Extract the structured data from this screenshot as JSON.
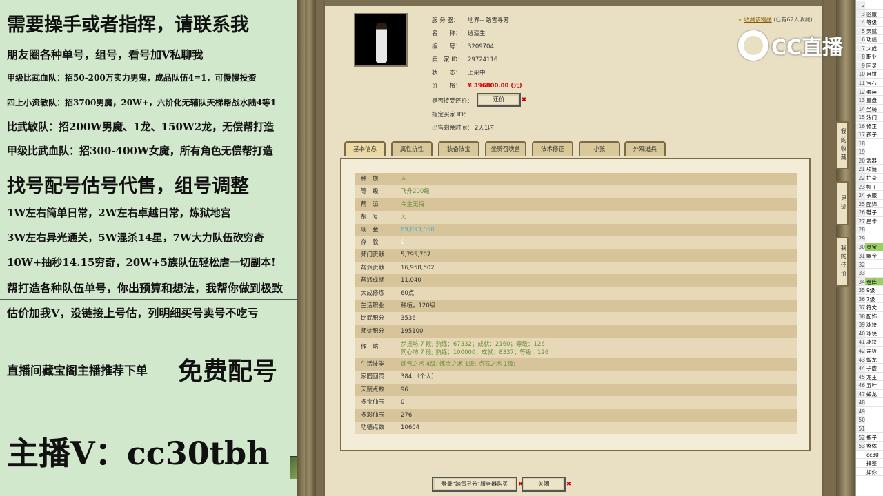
{
  "left_panel": {
    "lines": [
      "需要操手或者指挥，请联系我",
      "朋友圈各种单号，组号，看号加V私聊我",
      "甲级比武血队：招50-200万实力男鬼，成品队伍4=1，可慢慢投资",
      "四上小资敏队：招3700男魔，20W+，六阶化无辅队天梯帮战水陆4等1",
      "比武敏队：招200W男魔、1龙、150W2龙，无偿帮打造",
      "甲级比武血队：招300-400W女魔，所有角色无偿帮打造",
      "找号配号估号代售，组号调整",
      "1W左右简单日常，2W左右卓越日常，炼狱地宫",
      "3W左右异光通关，5W混杀14星，7W大力队伍砍穷奇",
      "10W+抽秒14.15穷奇，20W+5族队伍轻松虐一切副本!",
      "帮打造各种队伍单号，你出预算和想法，我帮你做到极致",
      "估价加我V，没链接上号估，列明细买号卖号不吃亏",
      "直播间藏宝阁主播推荐下单",
      "免费配号",
      "主播V：cc30tbh"
    ]
  },
  "watermark": "CC直播",
  "favorite": {
    "label": "收藏该物品",
    "count": "(已有62人收藏)"
  },
  "info": {
    "server_k": "服 务 器：",
    "server_v": "地界-- 踏雪寻芳",
    "name_k": "名　　称：",
    "name_v": "逍遥生",
    "id_k": "编　　号：",
    "id_v": "3209704",
    "seller_k": "卖　家 ID：",
    "seller_v": "29724116",
    "status_k": "状　　态：",
    "status_v": "上架中",
    "price_k": "价　　格：",
    "price_v": "¥ 396800.00 (元)",
    "bargain_k": "是否接受还价：",
    "bargain_btn": "还价",
    "buyer_k": "指定买家 ID：",
    "time_k": "出售剩余时间：",
    "time_v": "2天1时"
  },
  "tabs": [
    "基本信息",
    "属性抗性",
    "装备法宝",
    "坐骑召唤兽",
    "法术修正",
    "小孩",
    "外观道具"
  ],
  "rows": [
    {
      "k": "种　族",
      "v": "人"
    },
    {
      "k": "等　级",
      "v": "飞升200级"
    },
    {
      "k": "帮　派",
      "v": "今生无悔"
    },
    {
      "k": "靓　号",
      "v": "无"
    },
    {
      "k": "现　金",
      "v": "69,893,050"
    },
    {
      "k": "存　款",
      "v": "0"
    },
    {
      "k": "师门贡献",
      "v": "5,795,707"
    },
    {
      "k": "帮派贡献",
      "v": "16,958,502"
    },
    {
      "k": "帮派成就",
      "v": "11,040"
    },
    {
      "k": "大成修炼",
      "v": "60点"
    },
    {
      "k": "生活职业",
      "v": "种植，120级"
    },
    {
      "k": "比武积分",
      "v": "3536"
    },
    {
      "k": "师徒积分",
      "v": "195100"
    },
    {
      "k": "作　坊",
      "v": "步摇坊 7 段; 熟练：67332；成就：2160；等级：126",
      "v2": "同心坊 7 段; 熟练：100000；成就：8337；等级：126"
    },
    {
      "k": "生活技能",
      "v": "炼气之术 4级; 炼金之术 1级; 点石之术 1级;"
    },
    {
      "k": "家园回灵",
      "v": "384 （个人）"
    },
    {
      "k": "天赋点数",
      "v": "96"
    },
    {
      "k": "多宝仙玉",
      "v": "0"
    },
    {
      "k": "多彩仙玉",
      "v": "276"
    },
    {
      "k": "功德点数",
      "v": "10604"
    }
  ],
  "buttons": {
    "login": "登录“踏雪寻芳”服务器购买",
    "close": "关闭"
  },
  "side_buttons": [
    "我的收藏",
    "足迹",
    "我的还价"
  ],
  "sheet": [
    {
      "n": "2",
      "t": ""
    },
    {
      "n": "3",
      "t": "区服"
    },
    {
      "n": "4",
      "t": "等级"
    },
    {
      "n": "5",
      "t": "天赋"
    },
    {
      "n": "6",
      "t": "功绩"
    },
    {
      "n": "7",
      "t": "大成"
    },
    {
      "n": "8",
      "t": "职业"
    },
    {
      "n": "9",
      "t": "回灵"
    },
    {
      "n": "10",
      "t": "月饼"
    },
    {
      "n": "11",
      "t": "宝石"
    },
    {
      "n": "12",
      "t": "套装"
    },
    {
      "n": "13",
      "t": "星盘"
    },
    {
      "n": "14",
      "t": "坐骑"
    },
    {
      "n": "15",
      "t": "法门"
    },
    {
      "n": "16",
      "t": "修正"
    },
    {
      "n": "17",
      "t": "孩子"
    },
    {
      "n": "18",
      "t": ""
    },
    {
      "n": "19",
      "t": ""
    },
    {
      "n": "20",
      "t": "武器"
    },
    {
      "n": "21",
      "t": "项链"
    },
    {
      "n": "22",
      "t": "护身"
    },
    {
      "n": "23",
      "t": "帽子"
    },
    {
      "n": "24",
      "t": "衣服"
    },
    {
      "n": "25",
      "t": "配饰"
    },
    {
      "n": "26",
      "t": "鞋子"
    },
    {
      "n": "27",
      "t": "星卡"
    },
    {
      "n": "28",
      "t": ""
    },
    {
      "n": "29",
      "t": ""
    },
    {
      "n": "30",
      "t": "灵宝"
    },
    {
      "n": "31",
      "t": "飘金"
    },
    {
      "n": "32",
      "t": ""
    },
    {
      "n": "33",
      "t": ""
    },
    {
      "n": "34",
      "t": "仓库"
    },
    {
      "n": "35",
      "t": "9级"
    },
    {
      "n": "36",
      "t": "7级"
    },
    {
      "n": "37",
      "t": "符文"
    },
    {
      "n": "38",
      "t": "配饰"
    },
    {
      "n": "39",
      "t": "冰块"
    },
    {
      "n": "40",
      "t": "冰块"
    },
    {
      "n": "41",
      "t": "冰块"
    },
    {
      "n": "42",
      "t": "孟极"
    },
    {
      "n": "43",
      "t": "蛟龙"
    },
    {
      "n": "44",
      "t": "子虚"
    },
    {
      "n": "45",
      "t": "龙王"
    },
    {
      "n": "46",
      "t": "五叶"
    },
    {
      "n": "47",
      "t": "蛟龙"
    },
    {
      "n": "48",
      "t": ""
    },
    {
      "n": "49",
      "t": ""
    },
    {
      "n": "50",
      "t": ""
    },
    {
      "n": "51",
      "t": ""
    },
    {
      "n": "52",
      "t": "瓶子"
    },
    {
      "n": "53",
      "t": "整体"
    },
    {
      "n": "",
      "t": "cc30"
    },
    {
      "n": "",
      "t": "择鉴"
    },
    {
      "n": "",
      "t": "如你"
    }
  ]
}
